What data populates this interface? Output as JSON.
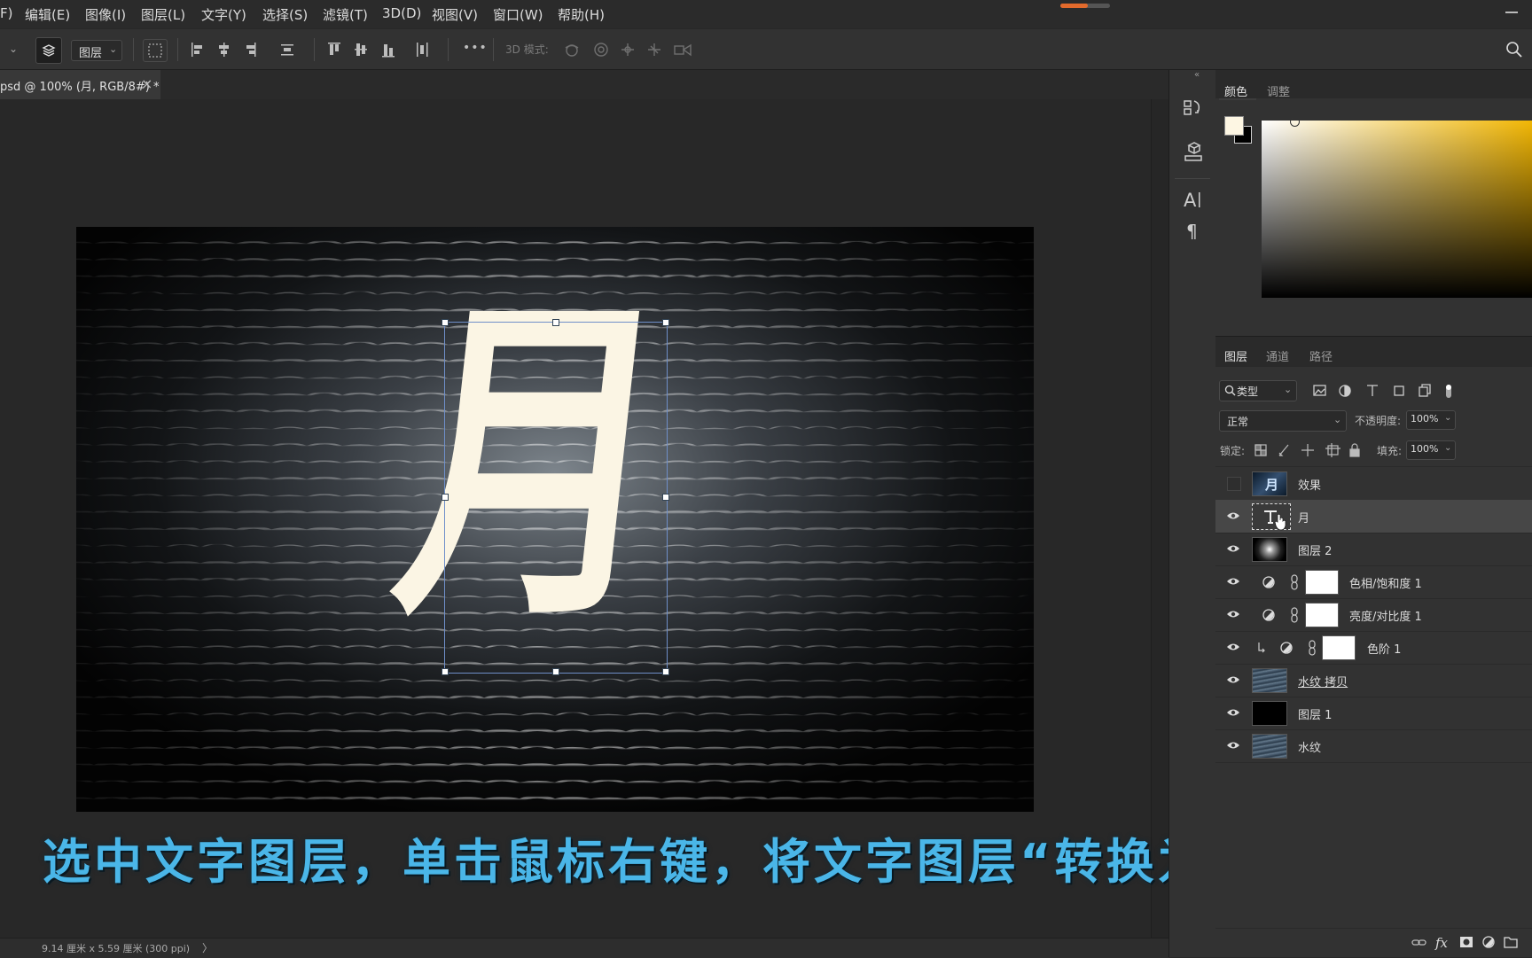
{
  "menu": [
    "F)",
    "编辑(E)",
    "图像(I)",
    "图层(L)",
    "文字(Y)",
    "选择(S)",
    "滤镜(T)",
    "3D(D)",
    "视图(V)",
    "窗口(W)",
    "帮助(H)"
  ],
  "titlebar": {
    "progress": 0.55
  },
  "options": {
    "auto_select_target": "图层",
    "mode_3d_label": "3D 模式:",
    "more_glyph": "•••"
  },
  "document": {
    "tab_title": "psd @ 100% (月, RGB/8#) *",
    "close_glyph": "×",
    "character": "月"
  },
  "status": {
    "doc_size": "9.14 厘米 x 5.59 厘米 (300 ppi)",
    "arrow": "〉"
  },
  "subtitle": "选中文字图层，单击鼠标右键，将文字图层“转换为智能对象”",
  "color_panel": {
    "tabs": [
      "颜色",
      "调整"
    ],
    "active_tab": 0,
    "foreground": "#fdf6e3",
    "background": "#000000",
    "hue_color": "#f2b705"
  },
  "layers_panel": {
    "tabs": [
      "图层",
      "通道",
      "路径"
    ],
    "filter_label": "类型",
    "blend_mode": "正常",
    "opacity_label": "不透明度:",
    "opacity_value": "100%",
    "lock_label": "锁定:",
    "fill_label": "填充:",
    "fill_value": "100%",
    "layers": [
      {
        "name": "效果",
        "visible": false,
        "type": "smart",
        "selected": false
      },
      {
        "name": "月",
        "visible": true,
        "type": "text",
        "selected": true
      },
      {
        "name": "图层 2",
        "visible": true,
        "type": "glow",
        "selected": false
      },
      {
        "name": "色相/饱和度 1",
        "visible": true,
        "type": "adjust",
        "selected": false
      },
      {
        "name": "亮度/对比度 1",
        "visible": true,
        "type": "adjust",
        "selected": false
      },
      {
        "name": "色阶 1",
        "visible": true,
        "type": "adjust-clipped",
        "selected": false
      },
      {
        "name": "水纹 拷贝",
        "visible": true,
        "type": "water",
        "selected": false
      },
      {
        "name": "图层 1",
        "visible": true,
        "type": "black",
        "selected": false
      },
      {
        "name": "水纹",
        "visible": true,
        "type": "water",
        "selected": false
      }
    ]
  }
}
